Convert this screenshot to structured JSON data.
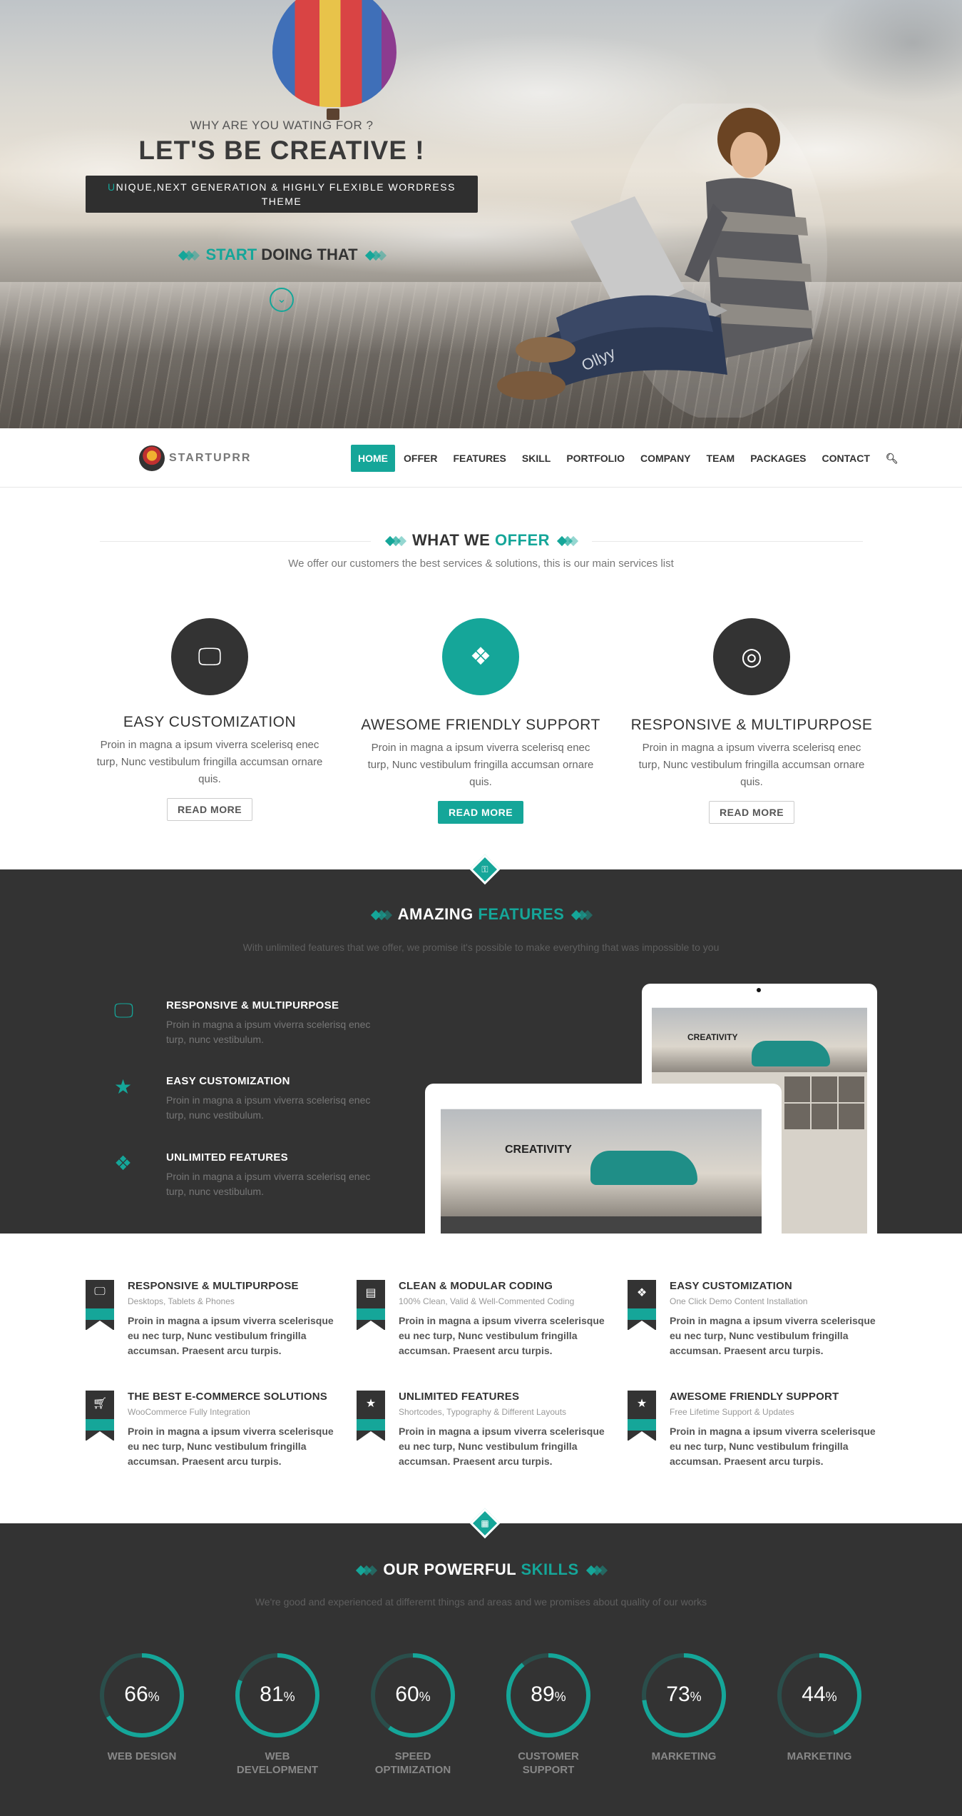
{
  "hero": {
    "subtitle": "WHY ARE YOU WATING FOR ?",
    "title": "LET'S BE CREATIVE !",
    "box_first_letter": "U",
    "box_text": "NIQUE,NEXT GENERATION & HIGHLY FLEXIBLE WORDRESS THEME",
    "cta_highlight": "START",
    "cta_rest": "DOING THAT",
    "down_icon": "chevron-down-icon",
    "laptop_text": "Ollyy"
  },
  "nav": {
    "logo_text": "STARTUPRR",
    "items": [
      "HOME",
      "OFFER",
      "FEATURES",
      "SKILL",
      "PORTFOLIO",
      "COMPANY",
      "TEAM",
      "PACKAGES",
      "CONTACT"
    ],
    "active": "HOME",
    "search_icon": "search-icon"
  },
  "offer": {
    "title_a": "WHAT WE",
    "title_b": "OFFER",
    "subtitle": "We offer our customers the best services & solutions, this is our main services list",
    "items": [
      {
        "icon": "monitor-icon",
        "title": "EASY CUSTOMIZATION",
        "text": "Proin in magna a ipsum viverra scelerisq enec turp, Nunc vestibulum fringilla accumsan ornare quis.",
        "button": "READ MORE"
      },
      {
        "icon": "puzzle-icon",
        "title": "AWESOME FRIENDLY SUPPORT",
        "text": "Proin in magna a ipsum viverra scelerisq enec turp, Nunc vestibulum fringilla accumsan ornare quis.",
        "button": "READ MORE"
      },
      {
        "icon": "lifebuoy-icon",
        "title": "RESPONSIVE & MULTIPURPOSE",
        "text": "Proin in magna a ipsum viverra scelerisq enec turp, Nunc vestibulum fringilla accumsan ornare quis.",
        "button": "READ MORE"
      }
    ]
  },
  "features": {
    "title_a": "AMAZING",
    "title_b": "FEATURES",
    "subtitle": "With unlimited features that we offer, we promise it's possible to make everything that was impossible to you",
    "items": [
      {
        "icon": "monitor-icon",
        "title": "RESPONSIVE & MULTIPURPOSE",
        "text": "Proin in magna a ipsum viverra scelerisq enec turp, nunc vestibulum."
      },
      {
        "icon": "star-icon",
        "title": "EASY CUSTOMIZATION",
        "text": "Proin in magna a ipsum viverra scelerisq enec turp, nunc vestibulum."
      },
      {
        "icon": "puzzle-icon",
        "title": "UNLIMITED FEATURES",
        "text": "Proin in magna a ipsum viverra scelerisq enec turp, nunc vestibulum."
      }
    ],
    "device_headline": "CREATIVITY"
  },
  "grid": {
    "items": [
      {
        "icon": "monitor-icon",
        "title": "RESPONSIVE & MULTIPURPOSE",
        "sub": "Desktops, Tablets & Phones",
        "text": "Proin in magna a ipsum viverra scelerisque eu nec turp, Nunc vestibulum fringilla accumsan. Praesent arcu turpis."
      },
      {
        "icon": "document-icon",
        "title": "CLEAN & MODULAR CODING",
        "sub": "100% Clean, Valid & Well-Commented Coding",
        "text": "Proin in magna a ipsum viverra scelerisque eu nec turp, Nunc vestibulum fringilla accumsan. Praesent arcu turpis."
      },
      {
        "icon": "puzzle-icon",
        "title": "EASY CUSTOMIZATION",
        "sub": "One Click Demo Content Installation",
        "text": "Proin in magna a ipsum viverra scelerisque eu nec turp, Nunc vestibulum fringilla accumsan. Praesent arcu turpis."
      },
      {
        "icon": "cart-icon",
        "title": "THE BEST E-COMMERCE SOLUTIONS",
        "sub": "WooCommerce Fully Integration",
        "text": "Proin in magna a ipsum viverra scelerisque eu nec turp, Nunc vestibulum fringilla accumsan. Praesent arcu turpis."
      },
      {
        "icon": "star-icon",
        "title": "UNLIMITED FEATURES",
        "sub": "Shortcodes, Typography & Different Layouts",
        "text": "Proin in magna a ipsum viverra scelerisque eu nec turp, Nunc vestibulum fringilla accumsan. Praesent arcu turpis."
      },
      {
        "icon": "star-icon",
        "title": "AWESOME FRIENDLY SUPPORT",
        "sub": "Free Lifetime Support & Updates",
        "text": "Proin in magna a ipsum viverra scelerisque eu nec turp, Nunc vestibulum fringilla accumsan. Praesent arcu turpis."
      }
    ]
  },
  "skills": {
    "title_a": "OUR POWERFUL",
    "title_b": "SKILLS",
    "subtitle": "We're good and experienced at differernt things and areas and we promises about quality of our works",
    "items": [
      {
        "value": 66,
        "label": "WEB DESIGN"
      },
      {
        "value": 81,
        "label": "WEB DEVELOPMENT"
      },
      {
        "value": 60,
        "label": "SPEED OPTIMIZATION"
      },
      {
        "value": 89,
        "label": "CUSTOMER SUPPORT"
      },
      {
        "value": 73,
        "label": "MARKETING"
      },
      {
        "value": 44,
        "label": "MARKETING"
      }
    ]
  },
  "colors": {
    "accent": "#15a699",
    "dark": "#333333"
  }
}
